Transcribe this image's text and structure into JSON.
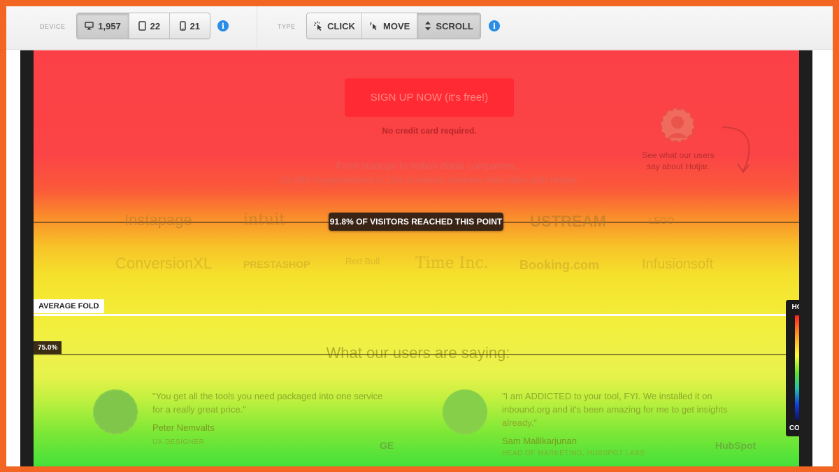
{
  "toolbar": {
    "device_label": "DEVICE",
    "devices": [
      {
        "icon": "desktop-icon",
        "count": "1,957",
        "active": true
      },
      {
        "icon": "tablet-icon",
        "count": "22",
        "active": false
      },
      {
        "icon": "phone-icon",
        "count": "21",
        "active": false
      }
    ],
    "type_label": "TYPE",
    "types": [
      {
        "icon": "click-icon",
        "label": "CLICK",
        "active": false
      },
      {
        "icon": "move-icon",
        "label": "MOVE",
        "active": false
      },
      {
        "icon": "scroll-icon",
        "label": "SCROLL",
        "active": true
      }
    ],
    "info_glyph": "i"
  },
  "page": {
    "cta_label": "SIGN UP NOW (it's free!)",
    "cta_note": "No credit card required.",
    "testimonial_link": "See what our users say about Hotjar.",
    "intro_line1": "From startups to million dollar companies...",
    "intro_line2": "24,959 Organizations in 134 countries improve their sites with Hotjar.",
    "logos_row1": [
      "Instapage",
      "intuit",
      "USTREAM",
      "LEGO"
    ],
    "logos_row2": [
      "ConversionXL",
      "PRESTASHOP",
      "Red Bull",
      "Time Inc.",
      "Booking.com",
      "Infusionsoft"
    ],
    "section_title": "What our users are saying:",
    "quotes": [
      {
        "text": "\"You get all the tools you need packaged into one service for a really great price.\"",
        "name": "Peter Nemvalts",
        "role": "UX DESIGNER",
        "company": "GE"
      },
      {
        "text": "\"I am ADDICTED to your tool, FYI. We installed it on inbound.org and it's been amazing for me to get insights already.\"",
        "name": "Sam Mallikarjunan",
        "role": "HEAD OF MARKETING, HUBSPOT LABS",
        "company": "HubSpot"
      }
    ]
  },
  "heatmap": {
    "reach_badge": "91.8% OF VISITORS REACHED THIS POINT",
    "reach_percent": 91.8,
    "average_fold_label": "AVERAGE FOLD",
    "marker_label": "75.0%",
    "marker_percent": 75.0,
    "legend_hot": "HOT",
    "legend_cold": "COLD",
    "colors": {
      "hot": "#fb4147",
      "warm": "#f3ee38",
      "cool": "#44e03b",
      "frame": "#f26522"
    }
  }
}
